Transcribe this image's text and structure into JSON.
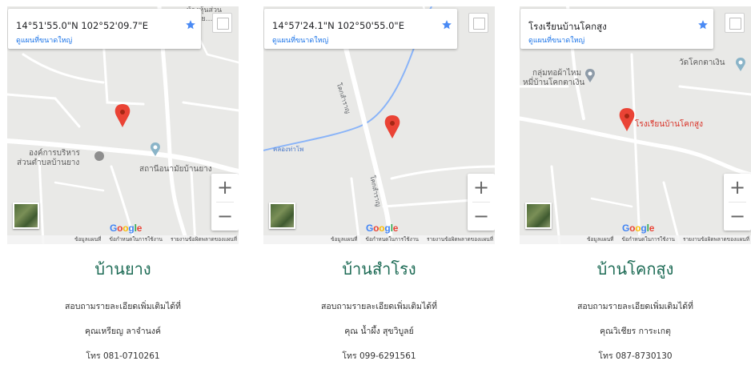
{
  "cards": [
    {
      "map": {
        "title": "14°51'55.0\"N 102°52'09.7\"E",
        "link": "ดูแผนที่ขนาดใหญ่",
        "labels": [
          "ห้างหุ้นส่วน",
          "ไพย...",
          "องค์การบริหาร",
          "ส่วนตำบลบ้านยาง",
          "สถานีอนามัยบ้านยาง"
        ],
        "google": "Google",
        "attribution": [
          "ข้อมูลแผนที่",
          "ข้อกำหนดในการใช้งาน",
          "รายงานข้อผิดพลาดของแผนที่"
        ],
        "zoom_in": "+",
        "zoom_out": "−"
      },
      "name": "บ้านยาง",
      "info": "สอบถามรายละเอียดเพิ่มเติมได้ที่",
      "contact": "คุณเหรียญ ลาจำนงค์",
      "phone": "โทร 081-0710261"
    },
    {
      "map": {
        "title": "14°57'24.1\"N 102°50'55.0\"E",
        "link": "ดูแผนที่ขนาดใหญ่",
        "labels": [
          "โคกสำราญ",
          "คลองท่าโพ",
          "โคกสำราญ"
        ],
        "google": "Google",
        "attribution": [
          "ข้อมูลแผนที่",
          "ข้อกำหนดในการใช้งาน",
          "รายงานข้อผิดพลาดของแผนที่"
        ],
        "zoom_in": "+",
        "zoom_out": "−"
      },
      "name": "บ้านสำโรง",
      "info": "สอบถามรายละเอียดเพิ่มเติมได้ที่",
      "contact": "คุณ น้ำผึ้ง สุขวิบูลย์",
      "phone": "โทร 099-6291561"
    },
    {
      "map": {
        "title": "โรงเรียนบ้านโคกสูง",
        "link": "ดูแผนที่ขนาดใหญ่",
        "labels": [
          "วัดโคกตาเงิน",
          "กลุ่มทอผ้าไหม",
          "หมี่บ้านโคกตาเงิน",
          "โรงเรียนบ้านโคกสูง"
        ],
        "google": "Google",
        "attribution": [
          "ข้อมูลแผนที่",
          "ข้อกำหนดในการใช้งาน",
          "รายงานข้อผิดพลาดของแผนที่"
        ],
        "zoom_in": "+",
        "zoom_out": "−"
      },
      "name": "บ้านโคกสูง",
      "info": "สอบถามรายละเอียดเพิ่มเติมได้ที่",
      "contact": "คุณวิเชียร การะเกตุ",
      "phone": "โทร 087-8730130"
    }
  ],
  "colors": {
    "accent_name": "#1d6b55",
    "pin": "#ea4335",
    "link": "#1a73e8",
    "star": "#4a8af4"
  }
}
